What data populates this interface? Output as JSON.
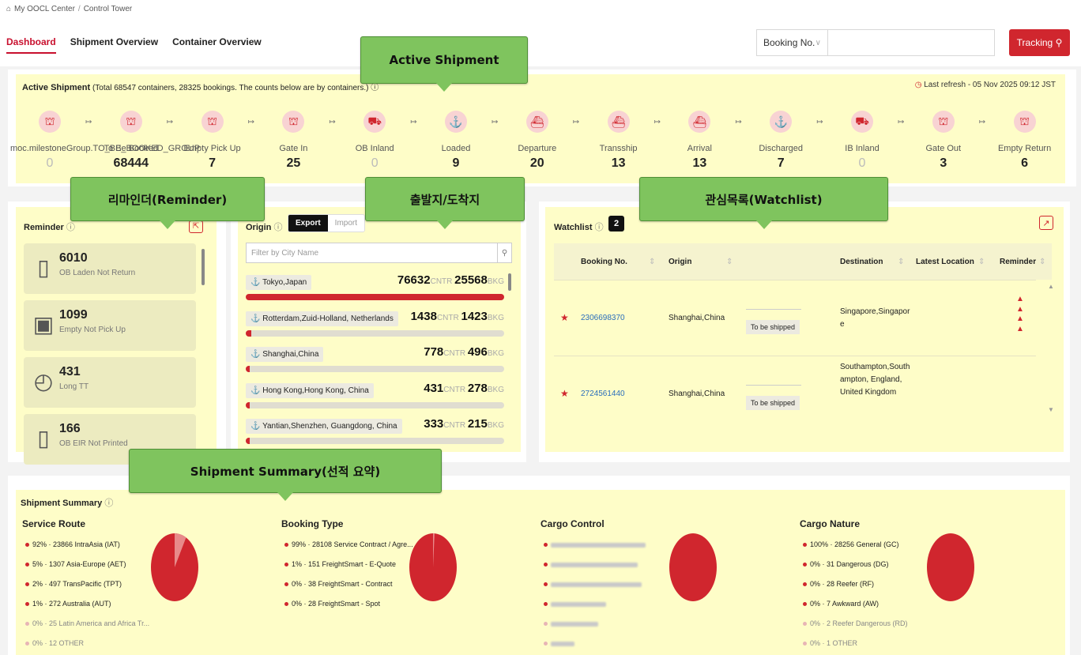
{
  "breadcrumb": {
    "home": "My OOCL Center",
    "separator": "/",
    "current": "Control Tower"
  },
  "nav": {
    "tabs": [
      "Dashboard",
      "Shipment Overview",
      "Container Overview"
    ],
    "active": "Dashboard"
  },
  "search": {
    "select_value": "Booking No.",
    "input_value": ""
  },
  "tracking_label": "Tracking",
  "colors": {
    "accent": "#d0262e",
    "highlight": "#fefdc8",
    "callout": "#7fc45e"
  },
  "callouts": {
    "active_shipment": "Active Shipment",
    "reminder": "리마인더(Reminder)",
    "origin": "출발지/도착지",
    "watchlist": "관심목록(Watchlist)",
    "summary": "Shipment Summary(선적 요약)"
  },
  "active_shipment": {
    "title": "Active Shipment",
    "subtitle": "(Total 68547 containers, 28325 bookings. The counts below are by containers.)",
    "refresh": "Last refresh - 05 Nov 2025 09:12 JST",
    "stages": [
      {
        "label": "moc.milestoneGroup.TO_BE_BOOKED_GROUP",
        "count": "0"
      },
      {
        "label": "To Be Booked",
        "count": "68444"
      },
      {
        "label": "Empty Pick Up",
        "count": "7"
      },
      {
        "label": "Gate In",
        "count": "25"
      },
      {
        "label": "OB Inland",
        "count": "0"
      },
      {
        "label": "Loaded",
        "count": "9"
      },
      {
        "label": "Departure",
        "count": "20"
      },
      {
        "label": "Transship",
        "count": "13"
      },
      {
        "label": "Arrival",
        "count": "13"
      },
      {
        "label": "Discharged",
        "count": "7"
      },
      {
        "label": "IB Inland",
        "count": "0"
      },
      {
        "label": "Gate Out",
        "count": "3"
      },
      {
        "label": "Empty Return",
        "count": "6"
      }
    ]
  },
  "reminder": {
    "title": "Reminder",
    "items": [
      {
        "value": "6010",
        "desc": "OB Laden Not Return",
        "icon": "document-icon"
      },
      {
        "value": "1099",
        "desc": "Empty Not Pick Up",
        "icon": "box-icon"
      },
      {
        "value": "431",
        "desc": "Long TT",
        "icon": "clock-icon"
      },
      {
        "value": "166",
        "desc": "OB EIR Not Printed",
        "icon": "document-icon"
      }
    ]
  },
  "origin": {
    "title": "Origin",
    "toggle": [
      "Export",
      "Import"
    ],
    "filter_placeholder": "Filter by City Name",
    "cntr_unit": "CNTR",
    "bkg_unit": "BKG",
    "rows": [
      {
        "city": "Tokyo,Japan",
        "cntr": "76632",
        "bkg": "25568",
        "share": 1.0
      },
      {
        "city": "Rotterdam,Zuid-Holland, Netherlands",
        "cntr": "1438",
        "bkg": "1423",
        "share": 0.02
      },
      {
        "city": "Shanghai,China",
        "cntr": "778",
        "bkg": "496",
        "share": 0.01
      },
      {
        "city": "Hong Kong,Hong Kong, China",
        "cntr": "431",
        "bkg": "278",
        "share": 0.006
      },
      {
        "city": "Yantian,Shenzhen, Guangdong, China",
        "cntr": "333",
        "bkg": "215",
        "share": 0.004
      }
    ]
  },
  "watchlist": {
    "title": "Watchlist",
    "count": "2",
    "columns": [
      "Booking No.",
      "Origin",
      "Destination",
      "Latest Location",
      "Reminder"
    ],
    "rows": [
      {
        "booking": "2306698370",
        "origin": "Shanghai,China",
        "status": "To be shipped",
        "destination": "Singapore,Singapor e"
      },
      {
        "booking": "2724561440",
        "origin": "Shanghai,China",
        "status": "To be shipped",
        "destination": "Southampton,South ampton, England, United Kingdom"
      }
    ]
  },
  "summary": {
    "title": "Shipment Summary",
    "columns": [
      {
        "heading": "Service Route",
        "items": [
          "92% · 23866 IntraAsia (IAT)",
          "5% · 1307 Asia-Europe (AET)",
          "2% · 497 TransPacific (TPT)",
          "1% · 272 Australia (AUT)",
          "0% · 25 Latin America and Africa Tr...",
          "0% · 12 OTHER"
        ],
        "pie_share": 0.92
      },
      {
        "heading": "Booking Type",
        "items": [
          "99% · 28108 Service Contract / Agre...",
          "1% · 151 FreightSmart - E-Quote",
          "0% · 38 FreightSmart - Contract",
          "0% · 28 FreightSmart - Spot"
        ],
        "pie_share": 0.99
      },
      {
        "heading": "Cargo Control",
        "items": [],
        "pie_share": 1.0
      },
      {
        "heading": "Cargo Nature",
        "items": [
          "100% · 28256 General (GC)",
          "0% · 31 Dangerous (DG)",
          "0% · 28 Reefer (RF)",
          "0% · 7 Awkward (AW)",
          "0% · 2 Reefer Dangerous (RD)",
          "0% · 1 OTHER"
        ],
        "pie_share": 1.0
      }
    ]
  }
}
